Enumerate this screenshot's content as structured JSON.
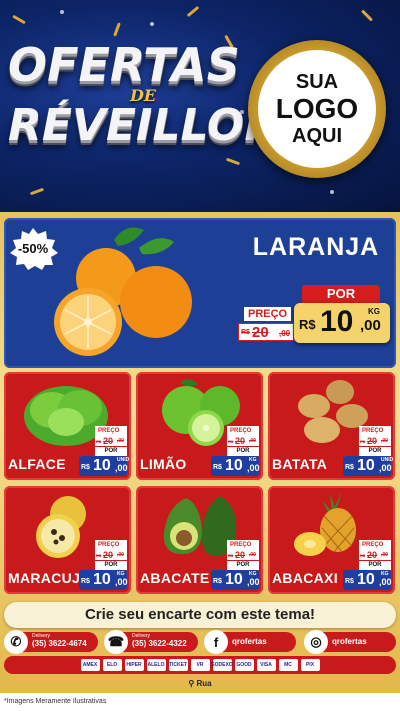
{
  "header": {
    "title_line1": "OFERTAS",
    "title_line2": "DE",
    "title_line3": "RÉVEILLON",
    "logo_line1": "SUA",
    "logo_line2": "LOGO",
    "logo_line3": "AQUI"
  },
  "featured": {
    "discount": "-50%",
    "name": "LARANJA",
    "preco_label": "PREÇO",
    "old_currency": "R$",
    "old_value": "20",
    "old_decimal": ",00",
    "por_label": "POR",
    "currency": "R$",
    "price_int": "10",
    "price_dec": ",00",
    "unit": "KG",
    "icon": "orange-icon"
  },
  "products": [
    {
      "name": "ALFACE",
      "preco_label": "PREÇO",
      "old_currency": "R$",
      "old_value": "20",
      "old_decimal": ",00",
      "por_label": "POR",
      "currency": "R$",
      "price_int": "10",
      "price_dec": ",00",
      "unit": "UNID",
      "icon": "lettuce-icon"
    },
    {
      "name": "LIMÃO",
      "preco_label": "PREÇO",
      "old_currency": "R$",
      "old_value": "20",
      "old_decimal": ",00",
      "por_label": "POR",
      "currency": "R$",
      "price_int": "10",
      "price_dec": ",00",
      "unit": "KG",
      "icon": "lime-icon"
    },
    {
      "name": "BATATA",
      "preco_label": "PREÇO",
      "old_currency": "R$",
      "old_value": "20",
      "old_decimal": ",00",
      "por_label": "POR",
      "currency": "R$",
      "price_int": "10",
      "price_dec": ",00",
      "unit": "UNID",
      "icon": "potato-icon"
    },
    {
      "name": "MARACUJÁ",
      "preco_label": "PREÇO",
      "old_currency": "R$",
      "old_value": "20",
      "old_decimal": ",00",
      "por_label": "POR",
      "currency": "R$",
      "price_int": "10",
      "price_dec": ",00",
      "unit": "KG",
      "icon": "passion-fruit-icon"
    },
    {
      "name": "ABACATE",
      "preco_label": "PREÇO",
      "old_currency": "R$",
      "old_value": "20",
      "old_decimal": ",00",
      "por_label": "POR",
      "currency": "R$",
      "price_int": "10",
      "price_dec": ",00",
      "unit": "KG",
      "icon": "avocado-icon"
    },
    {
      "name": "ABACAXI",
      "preco_label": "PREÇO",
      "old_currency": "R$",
      "old_value": "20",
      "old_decimal": ",00",
      "por_label": "POR",
      "currency": "R$",
      "price_int": "10",
      "price_dec": ",00",
      "unit": "KG",
      "icon": "pineapple-icon"
    }
  ],
  "cta": "Crie seu encarte com este tema!",
  "contacts": {
    "delivery1_label": "Delivery",
    "delivery1_phone": "(35) 3622-4674",
    "delivery2_label": "Delivery",
    "delivery2_phone": "(35) 3622-4322",
    "facebook": "qrofertas",
    "instagram": "qrofertas"
  },
  "payments": [
    "AMEX",
    "ELO",
    "HIPER",
    "ALELO",
    "TICKET",
    "VR",
    "SODEXO",
    "GOOD",
    "VISA",
    "MC",
    "PIX"
  ],
  "address": "Rua",
  "note": "*Imagens Meramente Ilustrativas",
  "colors": {
    "navy": "#0c2466",
    "red": "#c81a1a",
    "gold": "#e8c25a",
    "blue_price": "#1f3fa0"
  }
}
